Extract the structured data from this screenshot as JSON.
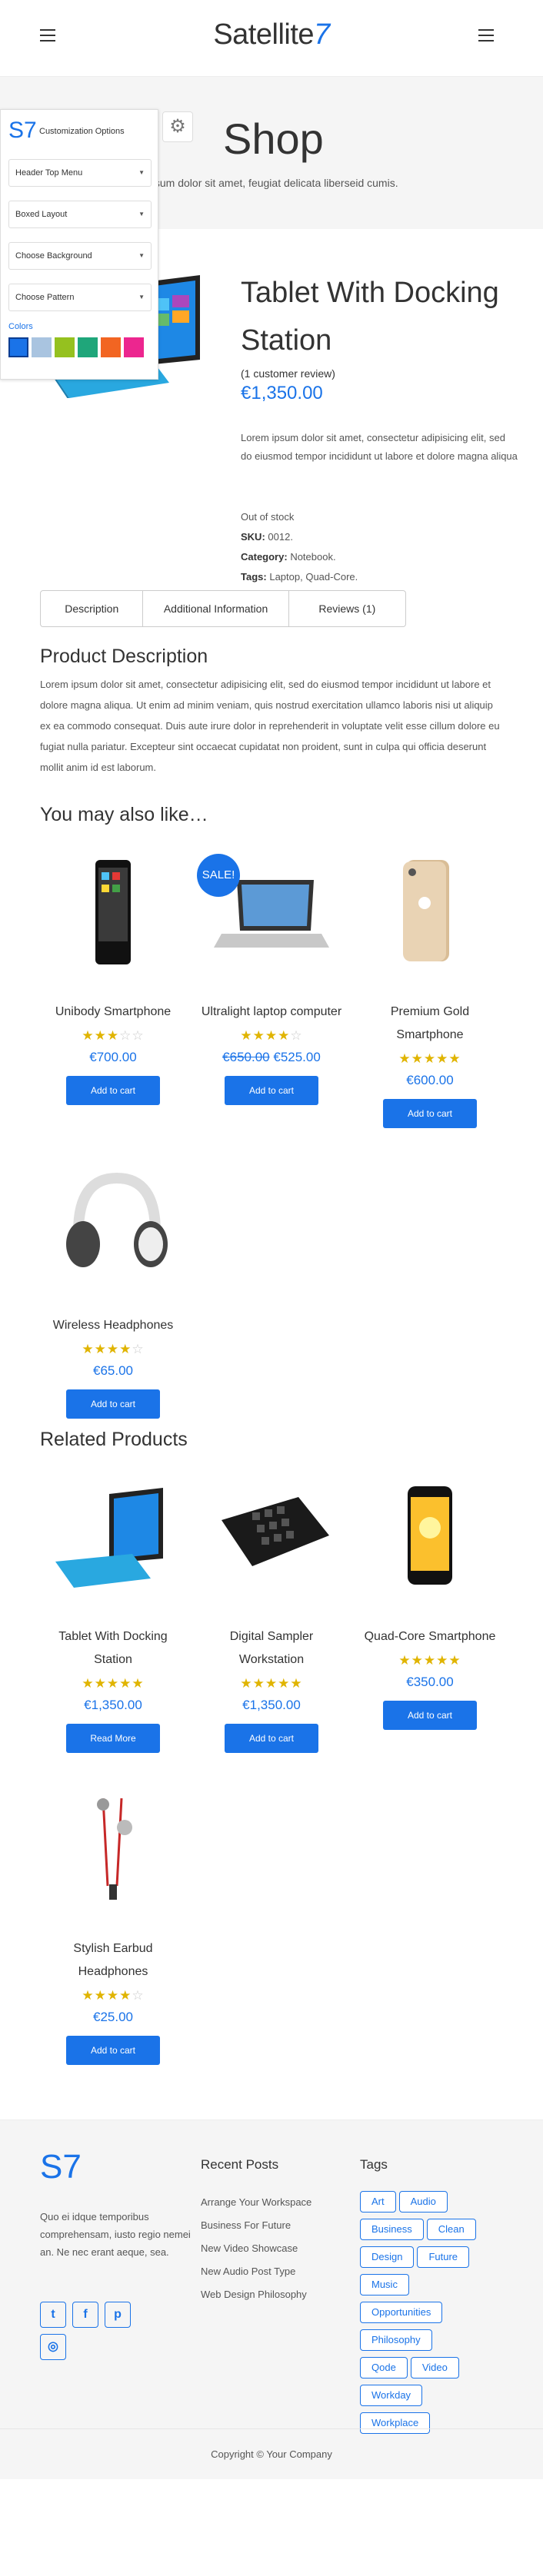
{
  "header": {
    "logo_text": "Satellite",
    "logo_accent": "7"
  },
  "banner": {
    "title": "Shop",
    "subtitle": "ipsum dolor sit amet, feugiat delicata liberseid cumis."
  },
  "customizer": {
    "logo": "S7",
    "title": "Customization Options",
    "selects": [
      "Header Top Menu",
      "Boxed Layout",
      "Choose Background",
      "Choose Pattern"
    ],
    "colors_label": "Colors",
    "colors": [
      "#1a73e8",
      "#a9c4e0",
      "#95c11f",
      "#1fa67a",
      "#f26522",
      "#ec268f"
    ]
  },
  "product": {
    "title": "Tablet With Docking Station",
    "reviews": "(1 customer review)",
    "price": "€1,350.00",
    "description": "Lorem ipsum dolor sit amet, consectetur adipisicing elit, sed do eiusmod tempor incididunt ut labore et dolore magna aliqua",
    "stock": "Out of stock",
    "sku_label": "SKU:",
    "sku": "0012.",
    "category_label": "Category:",
    "category": "Notebook.",
    "tags_label": "Tags:",
    "tags": "Laptop, Quad-Core."
  },
  "tabs": [
    "Description",
    "Additional Information",
    "Reviews (1)"
  ],
  "description_section": {
    "title": "Product Description",
    "text": "Lorem ipsum dolor sit amet, consectetur adipisicing elit, sed do eiusmod tempor incididunt ut labore et dolore magna aliqua. Ut enim ad minim veniam, quis nostrud exercitation ullamco laboris nisi ut aliquip ex ea commodo consequat. Duis aute irure dolor in reprehenderit in voluptate velit esse cillum dolore eu fugiat nulla pariatur. Excepteur sint occaecat cupidatat non proident, sunt in culpa qui officia deserunt mollit anim id est laborum."
  },
  "upsells": {
    "title": "You may also like…",
    "items": [
      {
        "name": "Unibody Smartphone",
        "rating": 3,
        "price": "€700.00",
        "old_price": "",
        "button": "Add to cart",
        "sale": ""
      },
      {
        "name": "Ultralight laptop computer",
        "rating": 4,
        "price": "€525.00",
        "old_price": "€650.00",
        "button": "Add to cart",
        "sale": "SALE!"
      },
      {
        "name": "Premium Gold Smartphone",
        "rating": 5,
        "price": "€600.00",
        "old_price": "",
        "button": "Add to cart",
        "sale": ""
      },
      {
        "name": "Wireless Headphones",
        "rating": 4,
        "price": "€65.00",
        "old_price": "",
        "button": "Add to cart",
        "sale": ""
      }
    ]
  },
  "related": {
    "title": "Related Products",
    "items": [
      {
        "name": "Tablet With Docking Station",
        "rating": 5,
        "price": "€1,350.00",
        "button": "Read More"
      },
      {
        "name": "Digital Sampler Workstation",
        "rating": 5,
        "price": "€1,350.00",
        "button": "Add to cart"
      },
      {
        "name": "Quad-Core Smartphone",
        "rating": 5,
        "price": "€350.00",
        "button": "Add to cart"
      },
      {
        "name": "Stylish Earbud Headphones",
        "rating": 4,
        "price": "€25.00",
        "button": "Add to cart"
      }
    ]
  },
  "footer": {
    "logo": "S7",
    "about": "Quo ei idque temporibus comprehensam, iusto regio nemei an. Ne nec erant aeque, sea.",
    "recent_title": "Recent Posts",
    "recent_posts": [
      "Arrange Your Workspace",
      "Business For Future",
      "New Video Showcase",
      "New Audio Post Type",
      "Web Design Philosophy"
    ],
    "tags_title": "Tags",
    "tags": [
      "Art",
      "Audio",
      "Business",
      "Clean",
      "Design",
      "Future",
      "Music",
      "Opportunities",
      "Philosophy",
      "Qode",
      "Video",
      "Workday",
      "Workplace"
    ],
    "copyright": "Copyright © Your Company"
  }
}
